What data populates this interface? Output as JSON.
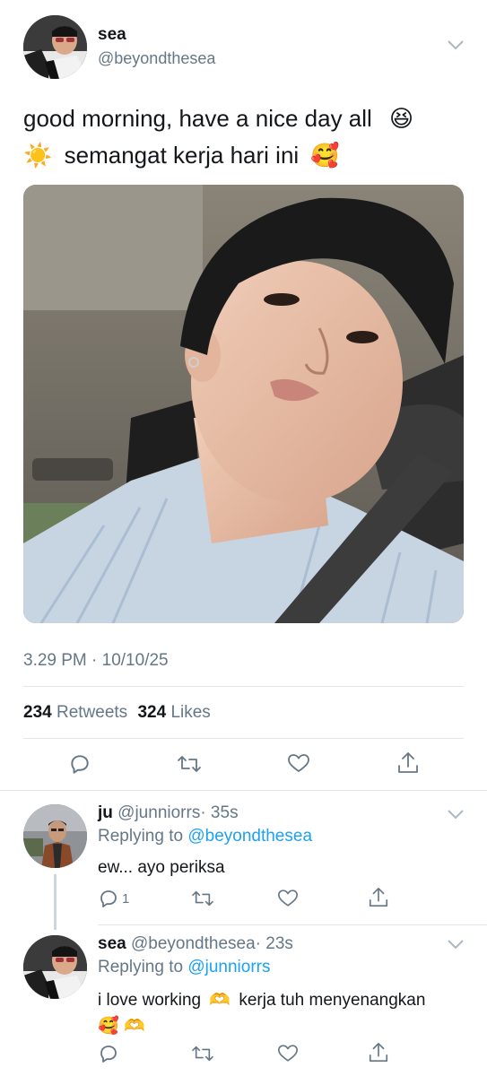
{
  "tweet": {
    "display_name": "sea",
    "handle": "@beyondthesea",
    "text_line1": "good morning, have a nice day all",
    "text_line2": "semangat kerja hari ini",
    "timestamp": "3.29 PM · 10/10/25",
    "retweet_count": "234",
    "retweet_label": "Retweets",
    "like_count": "324",
    "like_label": "Likes",
    "emoji_laugh": "😆",
    "emoji_sun": "☀️",
    "emoji_love": "🥰"
  },
  "replies": [
    {
      "display_name": "ju",
      "handle": "@junniorrs",
      "time": "· 35s",
      "replying_prefix": "Replying to",
      "replying_to": "@beyondthesea",
      "text": "ew... ayo periksa",
      "reply_count": "1"
    },
    {
      "display_name": "sea",
      "handle": "@beyondthesea",
      "time": "· 23s",
      "replying_prefix": "Replying to",
      "replying_to": "@junniorrs",
      "text_line1a": "i love working",
      "text_line1b": "kerja tuh menyenangkan",
      "emoji_hands": "🫶",
      "emoji_love": "🥰"
    }
  ],
  "colors": {
    "accent": "#1da1f2",
    "secondary_text": "#657786",
    "icon": "#657786",
    "divider": "#e1e8ed"
  },
  "icons": [
    "chevron-down-icon",
    "reply-icon",
    "retweet-icon",
    "like-icon",
    "share-icon"
  ]
}
